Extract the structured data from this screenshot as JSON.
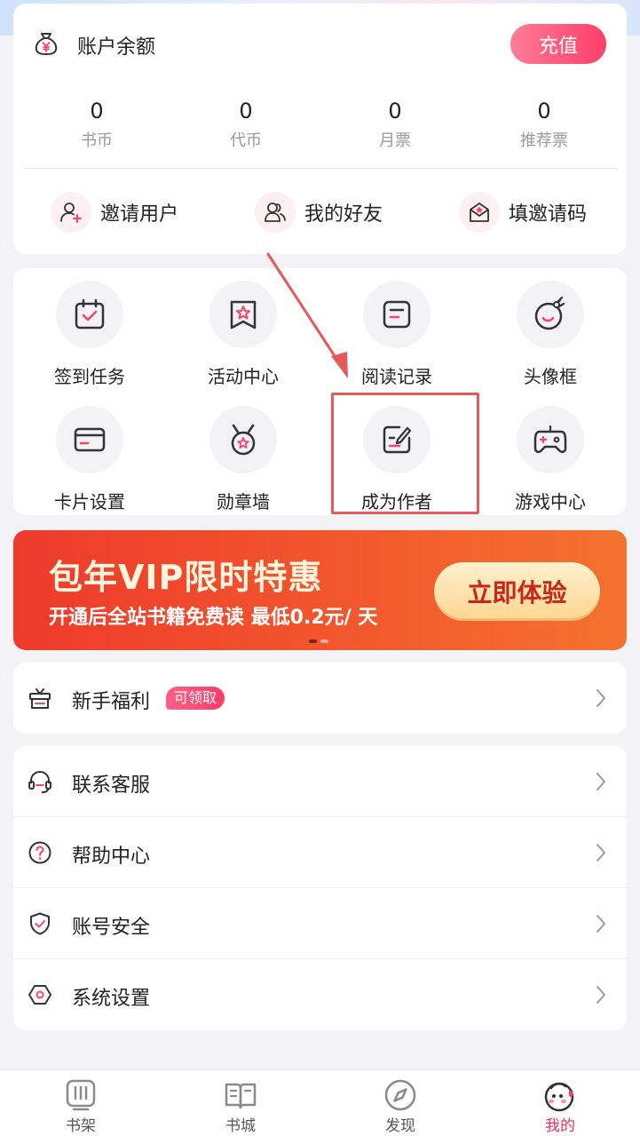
{
  "account": {
    "title": "账户余额",
    "recharge_label": "充值",
    "stats": [
      {
        "value": "0",
        "label": "书币"
      },
      {
        "value": "0",
        "label": "代币"
      },
      {
        "value": "0",
        "label": "月票"
      },
      {
        "value": "0",
        "label": "推荐票"
      }
    ],
    "actions": [
      {
        "label": "邀请用户",
        "icon": "invite-user-icon"
      },
      {
        "label": "我的好友",
        "icon": "friends-icon"
      },
      {
        "label": "填邀请码",
        "icon": "invite-code-icon"
      }
    ]
  },
  "features": {
    "items": [
      {
        "label": "签到任务",
        "icon": "calendar-check-icon"
      },
      {
        "label": "活动中心",
        "icon": "activity-star-icon"
      },
      {
        "label": "阅读记录",
        "icon": "reading-record-icon"
      },
      {
        "label": "头像框",
        "icon": "avatar-frame-icon"
      },
      {
        "label": "卡片设置",
        "icon": "card-icon"
      },
      {
        "label": "勋章墙",
        "icon": "medal-icon"
      },
      {
        "label": "成为作者",
        "icon": "become-author-icon"
      },
      {
        "label": "游戏中心",
        "icon": "gamepad-icon"
      }
    ]
  },
  "banner": {
    "title": "包年VIP限时特惠",
    "subtitle": "开通后全站书籍免费读 最低0.2元/ 天",
    "cta": "立即体验"
  },
  "list_newbie": {
    "label": "新手福利",
    "badge": "可领取",
    "icon": "gift-icon"
  },
  "list_main": [
    {
      "label": "联系客服",
      "icon": "headset-icon"
    },
    {
      "label": "帮助中心",
      "icon": "help-icon"
    },
    {
      "label": "账号安全",
      "icon": "shield-icon"
    },
    {
      "label": "系统设置",
      "icon": "settings-icon"
    }
  ],
  "tabbar": [
    {
      "label": "书架",
      "icon": "bookshelf-icon",
      "active": false
    },
    {
      "label": "书城",
      "icon": "bookstore-icon",
      "active": false
    },
    {
      "label": "发现",
      "icon": "compass-icon",
      "active": false
    },
    {
      "label": "我的",
      "icon": "profile-icon",
      "active": true
    }
  ],
  "colors": {
    "accent": "#ff3f6c",
    "banner": "#ee3a2c",
    "annotation": "#e45959",
    "active_tab": "#ee2e5a"
  }
}
